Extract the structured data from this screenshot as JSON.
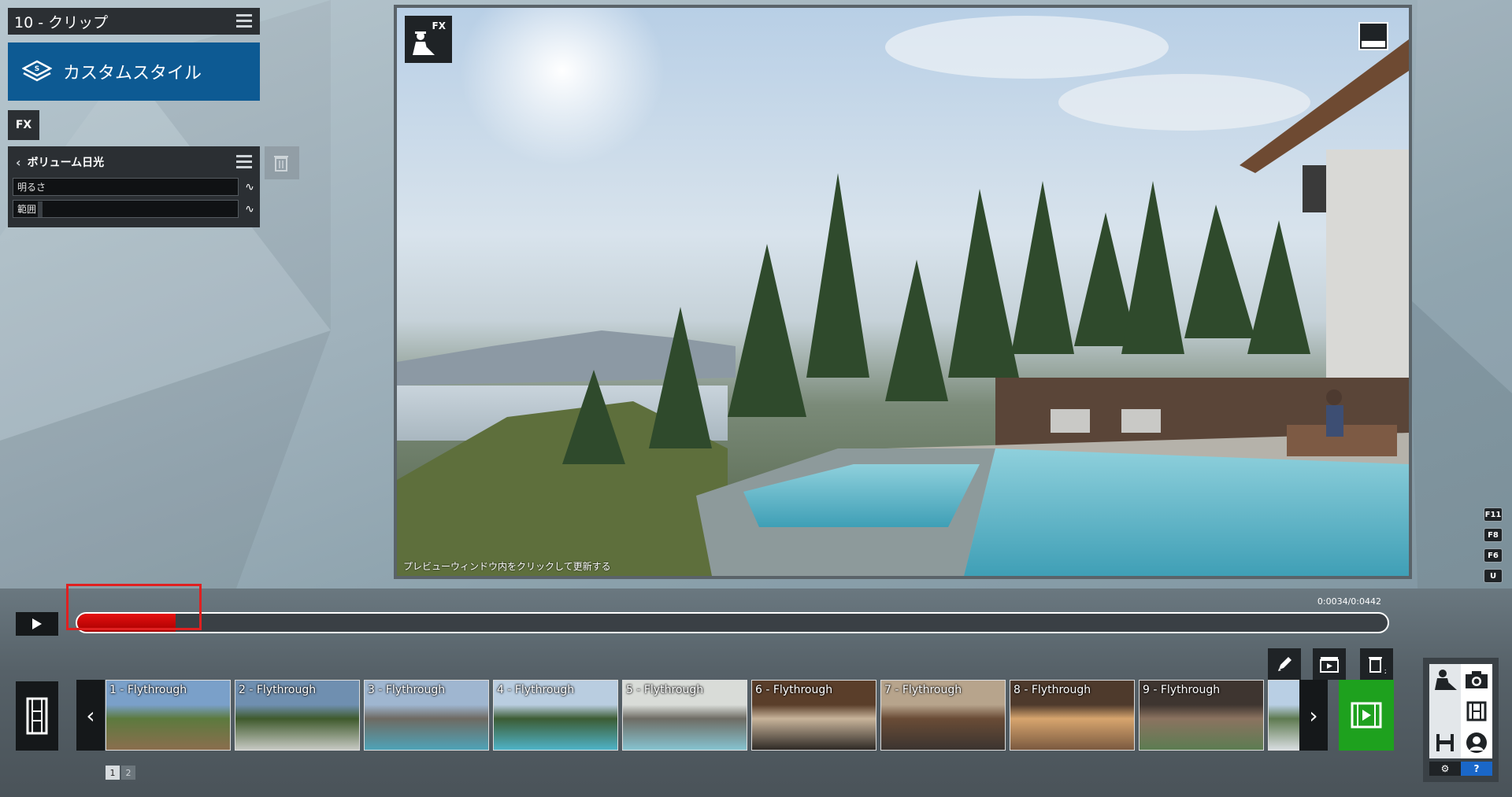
{
  "clip_header": {
    "title": "10 - クリップ"
  },
  "style": {
    "label": "カスタムスタイル"
  },
  "fx_tag": "FX",
  "effect": {
    "title": "ボリューム日光",
    "params": [
      {
        "label": "明るさ"
      },
      {
        "label": "範囲"
      }
    ]
  },
  "preview": {
    "fx_label": "FX",
    "hint": "プレビューウィンドウ内をクリックして更新する"
  },
  "side_keys": [
    "F11",
    "F8",
    "F6",
    "U"
  ],
  "timeline": {
    "time": "0:0034/0:0442",
    "progress": 0.075
  },
  "clips": [
    {
      "label": "1 - Flythrough",
      "palette": [
        "#7aa0c9",
        "#5c7a3e",
        "#8b6e4e"
      ]
    },
    {
      "label": "2 - Flythrough",
      "palette": [
        "#6f8fb0",
        "#3f5a2c",
        "#c7c9c3"
      ]
    },
    {
      "label": "3 - Flythrough",
      "palette": [
        "#9fb6d0",
        "#6e6a62",
        "#4fa3b8"
      ]
    },
    {
      "label": "4 - Flythrough",
      "palette": [
        "#b9cde0",
        "#3c5c34",
        "#4fb3c7"
      ]
    },
    {
      "label": "5 - Flythrough",
      "palette": [
        "#d9dcd8",
        "#6e6c64",
        "#86c3d0"
      ]
    },
    {
      "label": "6 - Flythrough",
      "palette": [
        "#5a3e2a",
        "#c8b49a",
        "#2f2a26"
      ]
    },
    {
      "label": "7 - Flythrough",
      "palette": [
        "#b7a48c",
        "#6a4c36",
        "#3b3430"
      ]
    },
    {
      "label": "8 - Flythrough",
      "palette": [
        "#4e3a2c",
        "#d7a56e",
        "#7b5a40"
      ]
    },
    {
      "label": "9 - Flythrough",
      "palette": [
        "#3e3530",
        "#8b7360",
        "#5c7c52"
      ]
    },
    {
      "label": "",
      "palette": [
        "#b9cfe4",
        "#5e7a50",
        "#d8dde0"
      ]
    }
  ],
  "pager": [
    "1",
    "2"
  ],
  "mode_panel": {
    "help_label": "?"
  },
  "colors": {
    "accent_blue": "#0d5a93",
    "timeline_red": "#d00000",
    "add_green": "#1ea11e",
    "highlight_red": "#e02020"
  }
}
